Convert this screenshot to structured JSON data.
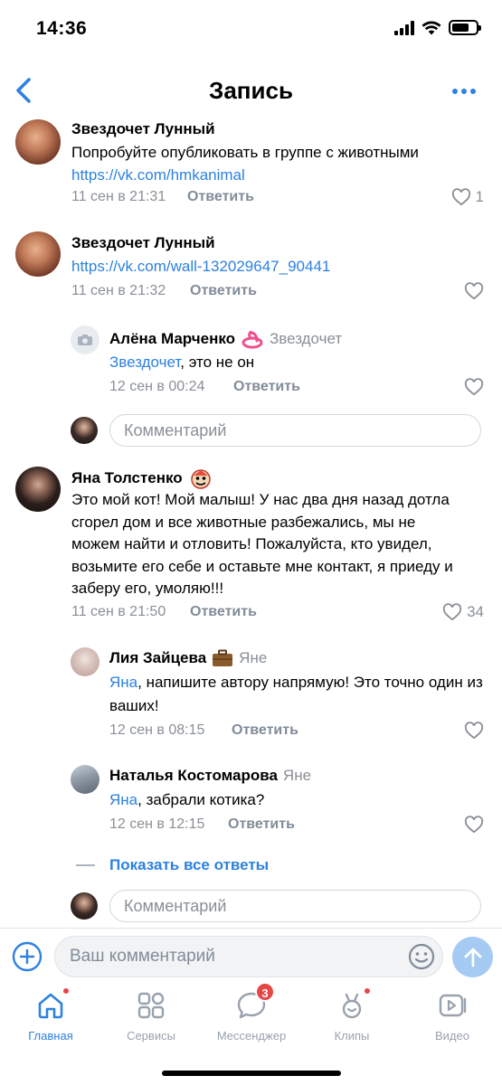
{
  "status_bar": {
    "time": "14:36"
  },
  "nav": {
    "title": "Запись"
  },
  "comments": [
    {
      "author": "Звездочет Лунный",
      "text": "Попробуйте опубликовать в группе с животными",
      "link": "https://vk.com/hmkanimal",
      "time": "11 сен в 21:31",
      "reply": "Ответить",
      "likes": "1"
    },
    {
      "author": "Звездочет Лунный",
      "link": "https://vk.com/wall-132029647_90441",
      "time": "11 сен в 21:32",
      "reply": "Ответить"
    },
    {
      "author": "Алёна Марченко",
      "reply_to": "Звездочет",
      "mention": "Звездочет",
      "text": ", это не он",
      "time": "12 сен в 00:24",
      "reply": "Ответить"
    },
    {
      "author": "Яна Толстенко",
      "text": "Это мой кот! Мой малыш! У нас два дня назад дотла сгорел дом и все животные разбежались, мы не можем найти и отловить! Пожалуйста, кто увидел, возьмите его себе и оставьте мне контакт, я приеду и заберу его, умоляю!!!",
      "time": "11 сен в 21:50",
      "reply": "Ответить",
      "likes": "34"
    },
    {
      "author": "Лия Зайцева",
      "reply_to": "Яне",
      "mention": "Яна",
      "text": ", напишите автору напрямую! Это точно один из ваших!",
      "time": "12 сен в 08:15",
      "reply": "Ответить"
    },
    {
      "author": "Наталья Костомарова",
      "reply_to": "Яне",
      "mention": "Яна",
      "text": ", забрали котика?",
      "time": "12 сен в 12:15",
      "reply": "Ответить"
    }
  ],
  "reply_input_placeholder": "Комментарий",
  "show_all_replies": "Показать все ответы",
  "compose": {
    "placeholder": "Ваш комментарий"
  },
  "tabbar": {
    "tabs": [
      {
        "label": "Главная",
        "icon": "home-icon",
        "active": true,
        "dot": true
      },
      {
        "label": "Сервисы",
        "icon": "services-icon"
      },
      {
        "label": "Мессенджер",
        "icon": "messenger-icon",
        "badge": "3"
      },
      {
        "label": "Клипы",
        "icon": "clips-icon",
        "dot": true
      },
      {
        "label": "Видео",
        "icon": "video-icon"
      }
    ]
  },
  "colors": {
    "accent": "#2d81e0",
    "secondary_text": "#8a8f96",
    "badge": "#e64646",
    "send_button": "#a6cbf3"
  }
}
